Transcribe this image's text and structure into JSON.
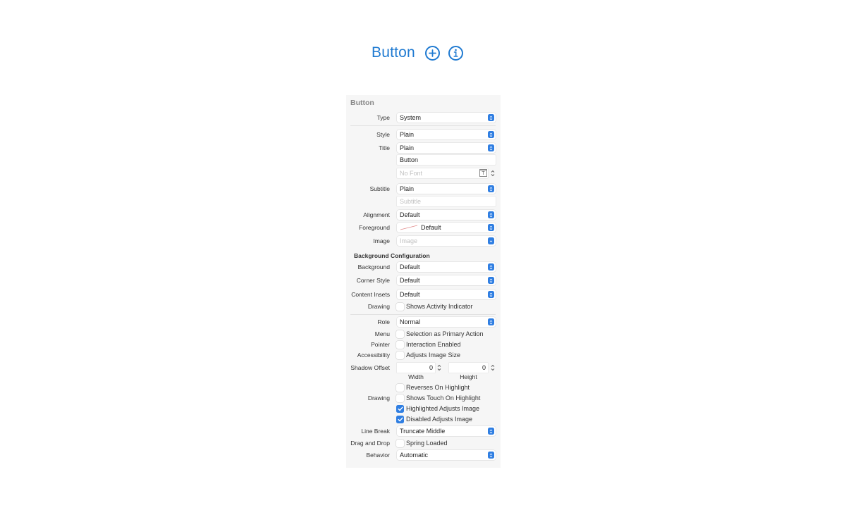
{
  "preview": {
    "title": "Button",
    "icons": [
      "plus-circle-icon",
      "info-circle-icon"
    ],
    "accent_color": "#1f7ad1"
  },
  "panel": {
    "title": "Button",
    "rows": {
      "type": {
        "label": "Type",
        "value": "System"
      },
      "style": {
        "label": "Style",
        "value": "Plain"
      },
      "title": {
        "label": "Title",
        "value": "Plain"
      },
      "title_text": {
        "value": "Button"
      },
      "font": {
        "placeholder": "No Font"
      },
      "subtitle": {
        "label": "Subtitle",
        "value": "Plain"
      },
      "subtitle_text": {
        "placeholder": "Subtitle"
      },
      "alignment": {
        "label": "Alignment",
        "value": "Default"
      },
      "foreground": {
        "label": "Foreground",
        "value": "Default"
      },
      "image": {
        "label": "Image",
        "placeholder": "Image"
      }
    },
    "background_config": {
      "title": "Background Configuration",
      "background": {
        "label": "Background",
        "value": "Default"
      },
      "corner_style": {
        "label": "Corner Style",
        "value": "Default"
      },
      "content_insets": {
        "label": "Content Insets",
        "value": "Default"
      },
      "drawing": {
        "label": "Drawing",
        "option": "Shows Activity Indicator",
        "checked": false
      }
    },
    "role": {
      "label": "Role",
      "value": "Normal"
    },
    "menu": {
      "label": "Menu",
      "option": "Selection as Primary Action",
      "checked": false
    },
    "pointer": {
      "label": "Pointer",
      "option": "Interaction Enabled",
      "checked": false
    },
    "accessibility": {
      "label": "Accessibility",
      "option": "Adjusts Image Size",
      "checked": false
    },
    "shadow_offset": {
      "label": "Shadow Offset",
      "width_value": "0",
      "height_value": "0",
      "width_label": "Width",
      "height_label": "Height"
    },
    "reverses": {
      "option": "Reverses On Highlight",
      "checked": false
    },
    "drawing": {
      "label": "Drawing",
      "option": "Shows Touch On Highlight",
      "checked": false
    },
    "highlighted_adjusts": {
      "option": "Highlighted Adjusts Image",
      "checked": true
    },
    "disabled_adjusts": {
      "option": "Disabled Adjusts Image",
      "checked": true
    },
    "line_break": {
      "label": "Line Break",
      "value": "Truncate Middle"
    },
    "drag_drop": {
      "label": "Drag and Drop",
      "option": "Spring Loaded",
      "checked": false
    },
    "behavior": {
      "label": "Behavior",
      "value": "Automatic"
    }
  },
  "colors": {
    "stepper_blue": "#2f7ee2",
    "panel_bg": "#f6f6f6"
  }
}
